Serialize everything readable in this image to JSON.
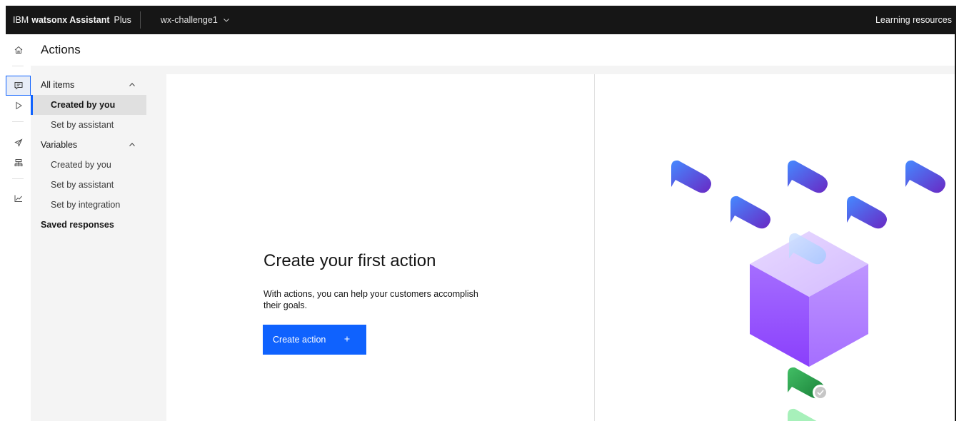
{
  "header": {
    "brand_prefix": "IBM",
    "brand_name": "watsonx Assistant",
    "plan": "Plus",
    "workspace": "wx-challenge1",
    "learning": "Learning resources"
  },
  "page": {
    "title": "Actions"
  },
  "rail": {
    "icons": [
      "home-icon",
      "actions-chat-icon",
      "preview-play-icon",
      "publish-rocket-icon",
      "environments-icon",
      "analytics-icon"
    ]
  },
  "subnav": {
    "all_items": {
      "label": "All items",
      "children": [
        "Created by you",
        "Set by assistant"
      ]
    },
    "variables": {
      "label": "Variables",
      "children": [
        "Created by you",
        "Set by assistant",
        "Set by integration"
      ]
    },
    "saved_responses": "Saved responses"
  },
  "empty_state": {
    "title": "Create your first action",
    "description": "With actions, you can help your customers accomplish their goals.",
    "button": "Create action"
  },
  "colors": {
    "primary": "#0f62fe",
    "header_bg": "#161616",
    "nav_bg": "#f4f4f4",
    "cube": "#a56eff",
    "success": "#24a148"
  }
}
